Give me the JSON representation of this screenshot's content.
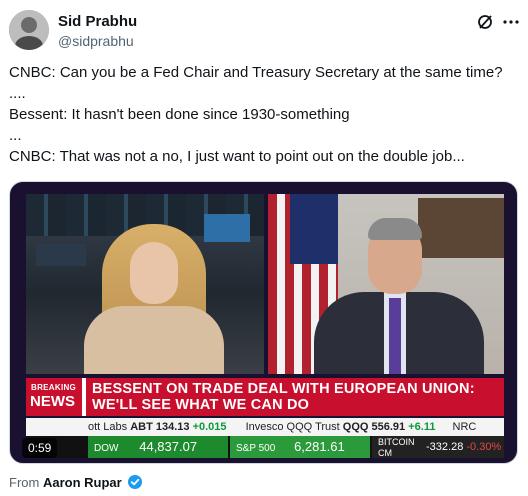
{
  "author": {
    "name": "Sid Prabhu",
    "handle": "@sidprabhu"
  },
  "tweet": {
    "lines": [
      "CNBC: Can you be a Fed Chair and Treasury Secretary at the same time?",
      "....",
      "Bessent: It hasn't been done since 1930-something",
      "...",
      "CNBC: That was not a no, I just want to point out on the double job..."
    ]
  },
  "video": {
    "duration": "0:59",
    "breaking_top": "BREAKING",
    "breaking_bottom": "NEWS",
    "headline_line1": "BESSENT ON TRADE DEAL WITH EUROPEAN UNION:",
    "headline_line2": "WE'LL SEE WHAT WE CAN DO",
    "ticker": {
      "item1_prefix": "ott Labs",
      "item1_symbol": "ABT 134.13",
      "item1_change": "+0.015",
      "item2_prefix": "Invesco QQQ Trust",
      "item2_symbol": "QQQ 556.91",
      "item2_change": "+6.11",
      "item3_prefix": "NRC"
    },
    "markets": {
      "dow_label": "DOW",
      "dow_value": "44,837.07",
      "sp_label": "S&P 500",
      "sp_value": "6,281.61",
      "bitcoin_label": "BITCOIN",
      "bitcoin_sub": "CM",
      "bitcoin_value": "-332.28",
      "bitcoin_pct": "-0.30%"
    }
  },
  "source": {
    "prefix": "From",
    "name": "Aaron Rupar"
  },
  "colors": {
    "breaking_red": "#c8102e",
    "verified_blue": "#1d9bf0",
    "muted_text": "#536471"
  },
  "icons": [
    "grok-icon",
    "more-icon",
    "verified-icon"
  ]
}
